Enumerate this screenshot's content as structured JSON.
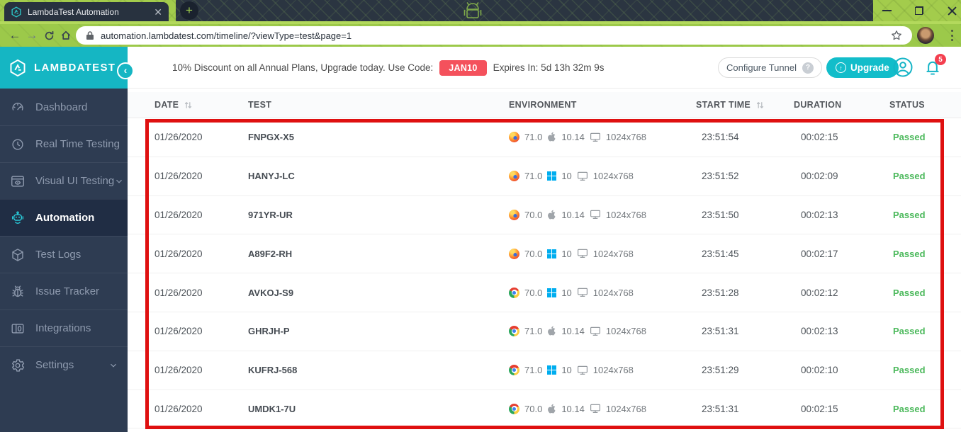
{
  "browser_chrome": {
    "tab_title": "LambdaTest Automation",
    "url": "automation.lambdatest.com/timeline/?viewType=test&page=1"
  },
  "app_header": {
    "brand": "LAMBDATEST",
    "promo_text_before_code": "10% Discount on all Annual Plans, Upgrade today. Use Code:",
    "promo_code": "JAN10",
    "promo_text_after_code": "Expires In: 5d 13h 32m 9s",
    "configure_tunnel_label": "Configure Tunnel",
    "upgrade_label": "Upgrade",
    "notifications_badge": "5"
  },
  "sidebar": {
    "items": [
      {
        "label": "Dashboard",
        "icon": "dashboard-icon",
        "active": false,
        "chevron": false
      },
      {
        "label": "Real Time Testing",
        "icon": "real-time-icon",
        "active": false,
        "chevron": false
      },
      {
        "label": "Visual UI Testing",
        "icon": "visual-ui-icon",
        "active": false,
        "chevron": true
      },
      {
        "label": "Automation",
        "icon": "automation-robot-icon",
        "active": true,
        "chevron": false
      },
      {
        "label": "Test Logs",
        "icon": "test-logs-icon",
        "active": false,
        "chevron": false
      },
      {
        "label": "Issue Tracker",
        "icon": "issue-tracker-icon",
        "active": false,
        "chevron": false
      },
      {
        "label": "Integrations",
        "icon": "integrations-icon",
        "active": false,
        "chevron": false
      },
      {
        "label": "Settings",
        "icon": "settings-icon",
        "active": false,
        "chevron": true
      }
    ]
  },
  "table": {
    "columns": [
      {
        "label": "DATE",
        "sortable": true
      },
      {
        "label": "TEST",
        "sortable": false
      },
      {
        "label": "ENVIRONMENT",
        "sortable": false
      },
      {
        "label": "START TIME",
        "sortable": true
      },
      {
        "label": "DURATION",
        "sortable": false
      },
      {
        "label": "STATUS",
        "sortable": false
      }
    ],
    "rows": [
      {
        "date": "01/26/2020",
        "test": "FNPGX-X5",
        "browser": "firefox",
        "browser_version": "71.0",
        "os": "mac",
        "os_version": "10.14",
        "resolution": "1024x768",
        "start_time": "23:51:54",
        "duration": "00:02:15",
        "status": "Passed"
      },
      {
        "date": "01/26/2020",
        "test": "HANYJ-LC",
        "browser": "firefox",
        "browser_version": "71.0",
        "os": "windows",
        "os_version": "10",
        "resolution": "1024x768",
        "start_time": "23:51:52",
        "duration": "00:02:09",
        "status": "Passed"
      },
      {
        "date": "01/26/2020",
        "test": "971YR-UR",
        "browser": "firefox",
        "browser_version": "70.0",
        "os": "mac",
        "os_version": "10.14",
        "resolution": "1024x768",
        "start_time": "23:51:50",
        "duration": "00:02:13",
        "status": "Passed"
      },
      {
        "date": "01/26/2020",
        "test": "A89F2-RH",
        "browser": "firefox",
        "browser_version": "70.0",
        "os": "windows",
        "os_version": "10",
        "resolution": "1024x768",
        "start_time": "23:51:45",
        "duration": "00:02:17",
        "status": "Passed"
      },
      {
        "date": "01/26/2020",
        "test": "AVKOJ-S9",
        "browser": "chrome",
        "browser_version": "70.0",
        "os": "windows",
        "os_version": "10",
        "resolution": "1024x768",
        "start_time": "23:51:28",
        "duration": "00:02:12",
        "status": "Passed"
      },
      {
        "date": "01/26/2020",
        "test": "GHRJH-P",
        "browser": "chrome",
        "browser_version": "71.0",
        "os": "mac",
        "os_version": "10.14",
        "resolution": "1024x768",
        "start_time": "23:51:31",
        "duration": "00:02:13",
        "status": "Passed"
      },
      {
        "date": "01/26/2020",
        "test": "KUFRJ-568",
        "browser": "chrome",
        "browser_version": "71.0",
        "os": "windows",
        "os_version": "10",
        "resolution": "1024x768",
        "start_time": "23:51:29",
        "duration": "00:02:10",
        "status": "Passed"
      },
      {
        "date": "01/26/2020",
        "test": "UMDK1-7U",
        "browser": "chrome",
        "browser_version": "70.0",
        "os": "mac",
        "os_version": "10.14",
        "resolution": "1024x768",
        "start_time": "23:51:31",
        "duration": "00:02:15",
        "status": "Passed"
      }
    ]
  },
  "colors": {
    "brand_teal": "#15b6c3",
    "chrome_theme_green": "#9cc94a",
    "sidebar_navy": "#2e3c52",
    "promo_code_red": "#f4515c",
    "status_passed_green": "#4cb95c",
    "annotation_red": "#df1010",
    "windows_blue": "#00adef"
  }
}
